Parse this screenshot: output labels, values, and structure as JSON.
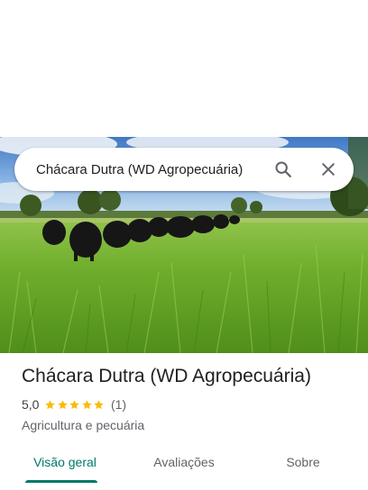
{
  "search": {
    "query": "Chácara Dutra (WD Agropecuária)",
    "search_icon": "search-icon",
    "close_icon": "close-icon"
  },
  "photo": {
    "subject": "cattle-herd-in-pasture"
  },
  "place": {
    "name": "Chácara Dutra (WD Agropecuária)",
    "rating": "5,0",
    "stars": 5,
    "reviews_count": "(1)",
    "category": "Agricultura e pecuária"
  },
  "tabs": [
    {
      "label": "Visão geral",
      "active": true
    },
    {
      "label": "Avaliações",
      "active": false
    },
    {
      "label": "Sobre",
      "active": false
    }
  ],
  "colors": {
    "accent": "#00796b",
    "star": "#fbbc04",
    "text_primary": "#202124",
    "text_secondary": "#5f6368"
  }
}
